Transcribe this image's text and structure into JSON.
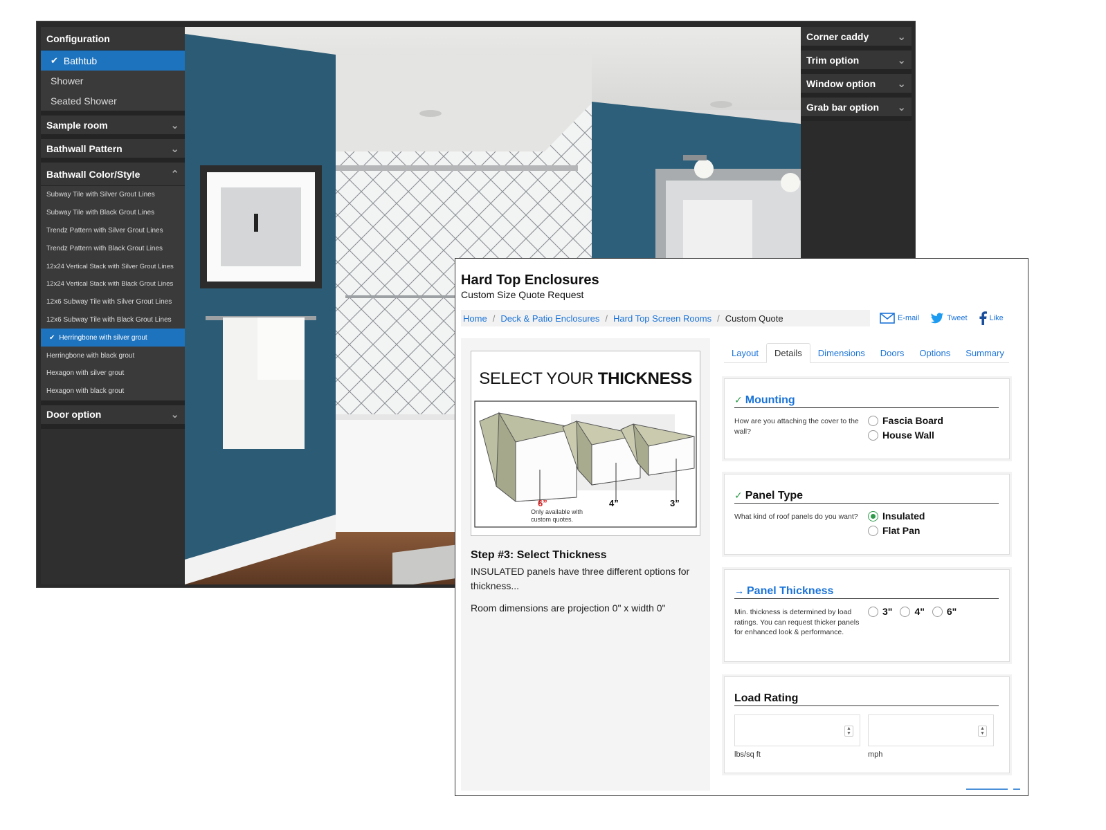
{
  "configurator": {
    "left_panel": {
      "configuration": {
        "header": "Configuration",
        "items": [
          "Bathtub",
          "Shower",
          "Seated Shower"
        ],
        "selected": "Bathtub"
      },
      "sample_room": "Sample room",
      "bathwall_pattern": "Bathwall Pattern",
      "bathwall_color": {
        "header": "Bathwall Color/Style",
        "items": [
          "Subway Tile with Silver Grout Lines",
          "Subway Tile with Black Grout Lines",
          "Trendz Pattern with Silver Grout Lines",
          "Trendz Pattern with Black Grout Lines",
          "12x24 Vertical Stack with Silver Grout Lines",
          "12x24 Vertical Stack with Black Grout Lines",
          "12x6 Subway Tile with Silver Grout Lines",
          "12x6 Subway Tile with Black Grout Lines",
          "Herringbone with silver grout",
          "Herringbone with black grout",
          "Hexagon with silver grout",
          "Hexagon with black grout"
        ],
        "selected": "Herringbone with silver grout"
      },
      "door_option": "Door option"
    },
    "right_panel": {
      "corner_caddy": "Corner caddy",
      "trim_option": "Trim option",
      "window_option": "Window option",
      "grab_bar_option": "Grab bar option"
    }
  },
  "quote": {
    "title": "Hard Top Enclosures",
    "subtitle": "Custom Size Quote Request",
    "breadcrumb": {
      "home": "Home",
      "deck": "Deck & Patio Enclosures",
      "screen_rooms": "Hard Top Screen Rooms",
      "current": "Custom Quote",
      "sep": "/"
    },
    "share": {
      "email": "E-mail",
      "tweet": "Tweet",
      "like": "Like"
    },
    "figure": {
      "title_light": "SELECT YOUR",
      "title_bold": "THICKNESS",
      "label_6": "6”",
      "label_4": "4”",
      "label_3": "3”",
      "note": "Only available with custom quotes."
    },
    "step_title": "Step #3: Select Thickness",
    "step_desc": "INSULATED panels have three different options for thickness...",
    "room_dims": "Room dimensions are projection 0\" x width 0\"",
    "tabs": [
      "Layout",
      "Details",
      "Dimensions",
      "Doors",
      "Options",
      "Summary"
    ],
    "active_tab": "Details",
    "mounting": {
      "mark": "✓",
      "title": "Mounting",
      "question": "How are you attaching the cover to the wall?",
      "options": [
        "Fascia Board",
        "House Wall"
      ]
    },
    "panel_type": {
      "mark": "✓",
      "title": "Panel Type",
      "question": "What kind of roof panels do you want?",
      "options": [
        "Insulated",
        "Flat Pan"
      ],
      "selected": "Insulated"
    },
    "panel_thickness": {
      "mark": "→",
      "title": "Panel Thickness",
      "question": "Min. thickness is determined by load ratings. You can request thicker panels for enhanced look & performance.",
      "options": [
        "3\"",
        "4\"",
        "6\""
      ]
    },
    "load_rating": {
      "title": "Load Rating",
      "unit_1": "lbs/sq ft",
      "unit_2": "mph",
      "value_1": "",
      "value_2": ""
    }
  },
  "colors": {
    "accent_blue": "#1e73be",
    "link_blue": "#1a73d9",
    "check_green": "#2e9b4b",
    "panel_dark": "#2f2f2f"
  }
}
